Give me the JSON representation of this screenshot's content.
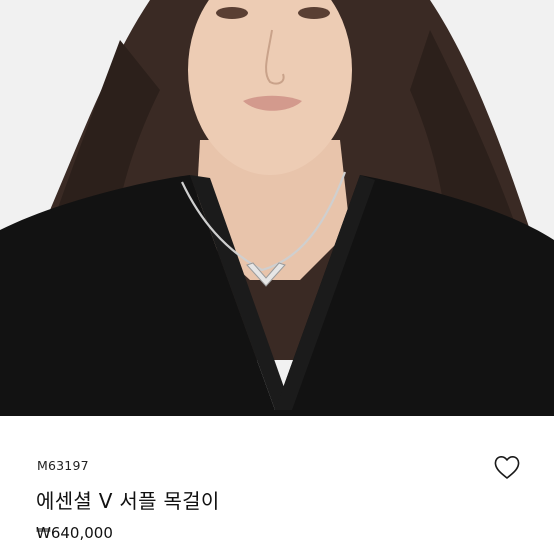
{
  "product": {
    "sku": "M63197",
    "name": "에센셜 V 서플 목걸이",
    "price": "₩640,000"
  },
  "icons": {
    "wishlist": "heart-outline-icon"
  },
  "colors": {
    "background": "#ffffff",
    "text": "#111111",
    "hero_background": "#f1f1f1"
  }
}
